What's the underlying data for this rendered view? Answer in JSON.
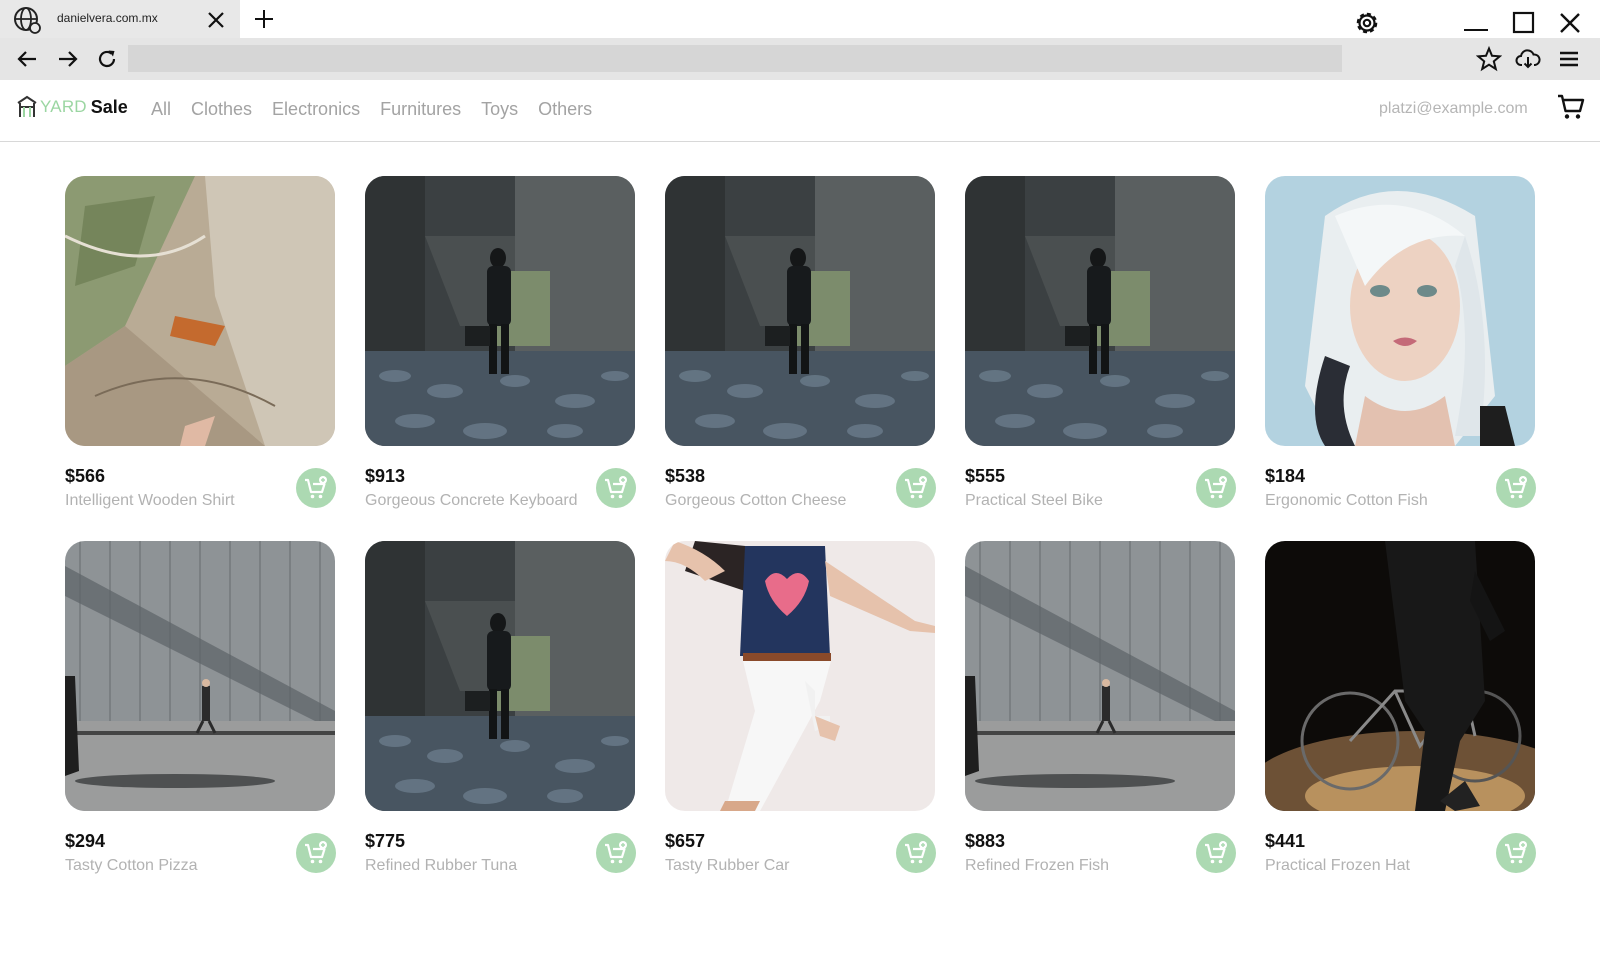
{
  "browser": {
    "tab_title": "danielvera.com.mx",
    "url": "",
    "icons": {
      "favicon": "globe-icon",
      "tab_close": "close-icon",
      "new_tab": "plus-icon",
      "settings": "gear-icon",
      "minimize": "minimize-icon",
      "maximize": "maximize-icon",
      "close": "close-icon",
      "back": "arrow-left-icon",
      "forward": "arrow-right-icon",
      "reload": "reload-icon",
      "bookmark": "star-icon",
      "download": "cloud-download-icon",
      "menu": "hamburger-menu-icon"
    }
  },
  "header": {
    "logo_yard": "YARD",
    "logo_sale": "Sale",
    "categories": [
      "All",
      "Clothes",
      "Electronics",
      "Furnitures",
      "Toys",
      "Others"
    ],
    "user_email": "platzi@example.com",
    "cart_icon": "shopping-cart-icon"
  },
  "colors": {
    "accent": "#9bd6a2",
    "add_button": "#acd9b2",
    "muted_text": "#a3a3a3"
  },
  "products": [
    {
      "price": "$566",
      "name": "Intelligent Wooden Shirt",
      "image": "rock-closeup"
    },
    {
      "price": "$913",
      "name": "Gorgeous Concrete Keyboard",
      "image": "dark-corridor-figure"
    },
    {
      "price": "$538",
      "name": "Gorgeous Cotton Cheese",
      "image": "dark-corridor-figure"
    },
    {
      "price": "$555",
      "name": "Practical Steel Bike",
      "image": "dark-corridor-figure"
    },
    {
      "price": "$184",
      "name": "Ergonomic Cotton Fish",
      "image": "platinum-hair-portrait"
    },
    {
      "price": "$294",
      "name": "Tasty Cotton Pizza",
      "image": "man-walking-by-wall"
    },
    {
      "price": "$775",
      "name": "Refined Rubber Tuna",
      "image": "dark-corridor-figure"
    },
    {
      "price": "$657",
      "name": "Tasty Rubber Car",
      "image": "woman-jumping-heart-tee"
    },
    {
      "price": "$883",
      "name": "Refined Frozen Fish",
      "image": "man-walking-by-wall"
    },
    {
      "price": "$441",
      "name": "Practical Frozen Hat",
      "image": "person-with-bicycle"
    }
  ]
}
